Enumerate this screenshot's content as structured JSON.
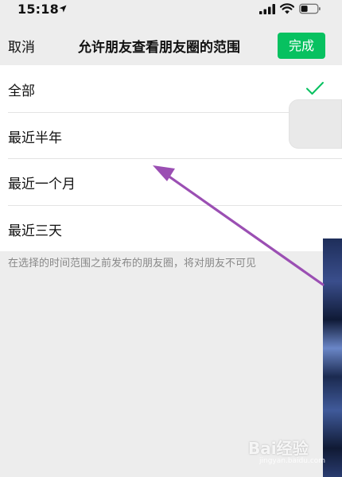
{
  "status_bar": {
    "time": "15:18",
    "icons": [
      "location-arrow-icon",
      "signal-icon",
      "wifi-icon",
      "battery-icon"
    ]
  },
  "nav": {
    "cancel_label": "取消",
    "title": "允许朋友查看朋友圈的范围",
    "done_label": "完成"
  },
  "options": [
    {
      "label": "全部",
      "selected": true
    },
    {
      "label": "最近半年",
      "selected": false
    },
    {
      "label": "最近一个月",
      "selected": false
    },
    {
      "label": "最近三天",
      "selected": false
    }
  ],
  "hint": "在选择的时间范围之前发布的朋友圈，将对朋友不可见",
  "watermark": {
    "text": "Bai经验",
    "sub": "jingyan.baidu.com"
  },
  "colors": {
    "background": "#ededed",
    "accent": "#07c160",
    "annotation_arrow": "#9b4fb3"
  }
}
